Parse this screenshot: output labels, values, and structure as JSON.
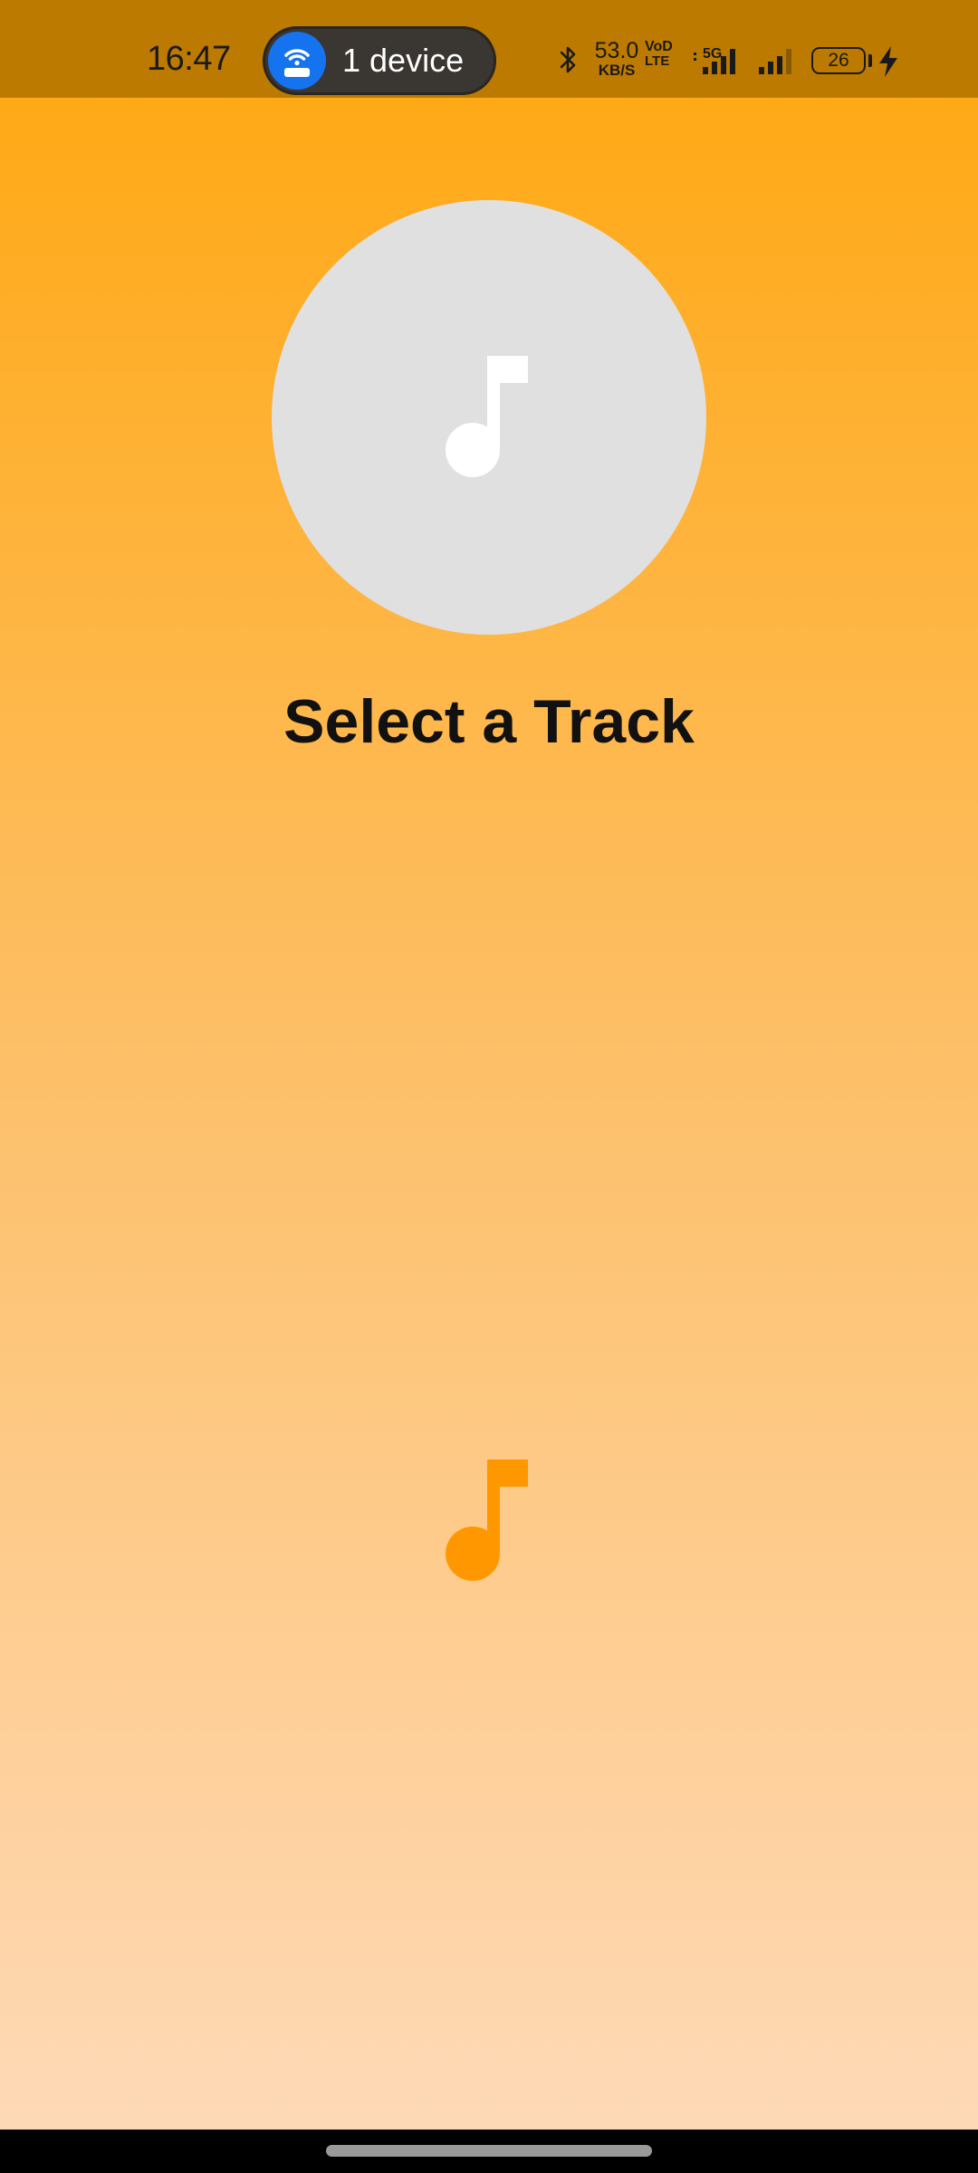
{
  "status_bar": {
    "time": "16:47",
    "hotspot_label": "1 device",
    "hotspot_icon": "wifi-router-icon",
    "bluetooth_icon": "bluetooth-icon",
    "net_speed_value": "53.0",
    "net_speed_unit": "KB/S",
    "volte_top": "VoD",
    "volte_bottom": "LTE",
    "network_type": "5G",
    "signal_icon_1": "cellular-signal-icon",
    "signal_icon_2": "cellular-signal-icon",
    "battery_level": "26",
    "charging_icon": "lightning-bolt-icon"
  },
  "player": {
    "album_art_icon": "music-note-icon",
    "title": "Select a Track",
    "lower_icon": "music-note-icon"
  },
  "colors": {
    "accent": "#FF9800",
    "status_bar_bg": "#BD7A00",
    "gradient_top": "#FFA812",
    "gradient_bottom": "#FED9B6",
    "album_art_bg": "#E0E0E0",
    "hotspot_icon_bg": "#1673F0"
  }
}
